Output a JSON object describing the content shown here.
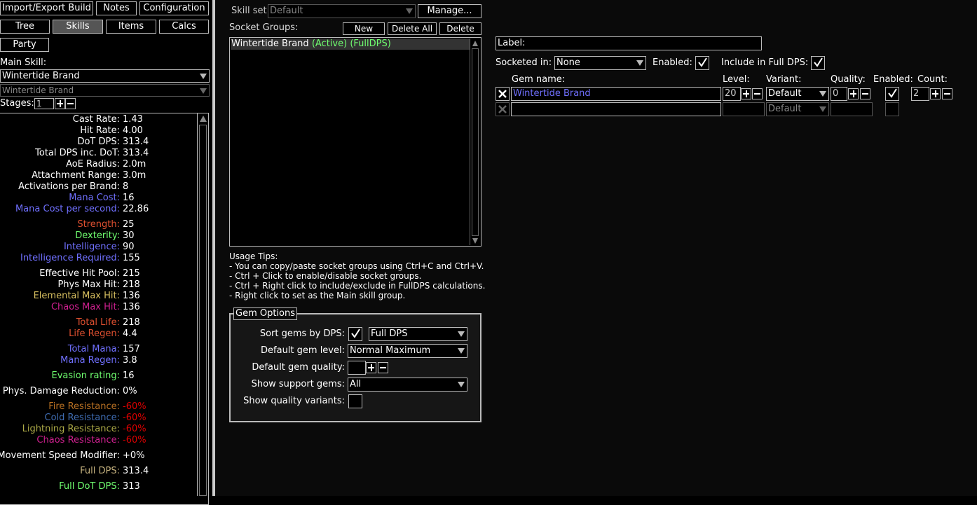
{
  "topbar": {
    "import_export": "Import/Export Build",
    "notes": "Notes",
    "configuration": "Configuration",
    "tabs": [
      "Tree",
      "Skills",
      "Items",
      "Calcs"
    ],
    "party": "Party"
  },
  "sidebar": {
    "main_skill_label": "Main Skill:",
    "main_skill": "Wintertide Brand",
    "sub_skill": "Wintertide Brand",
    "stages_label": "Stages:",
    "stages_value": "1",
    "stats": [
      {
        "label": "Cast Rate:",
        "value": "1.43",
        "cls": ""
      },
      {
        "label": "Hit Rate:",
        "value": "4.00",
        "cls": ""
      },
      {
        "label": "DoT DPS:",
        "value": "313.4",
        "cls": ""
      },
      {
        "label": "Total DPS inc. DoT:",
        "value": "313.4",
        "cls": ""
      },
      {
        "label": "AoE Radius:",
        "value": "2.0m",
        "cls": ""
      },
      {
        "label": "Attachment Range:",
        "value": "3.0m",
        "cls": ""
      },
      {
        "label": "Activations per Brand:",
        "value": "8",
        "cls": ""
      },
      {
        "label": "Mana Cost:",
        "value": "16",
        "cls": "c-mana"
      },
      {
        "label": "Mana Cost per second:",
        "value": "22.86",
        "cls": "c-mana"
      },
      {
        "label": "Strength:",
        "value": "25",
        "cls": "c-str",
        "gap": true
      },
      {
        "label": "Dexterity:",
        "value": "30",
        "cls": "c-dex"
      },
      {
        "label": "Intelligence:",
        "value": "90",
        "cls": "c-int"
      },
      {
        "label": "Intelligence Required:",
        "value": "155",
        "cls": "c-int"
      },
      {
        "label": "Effective Hit Pool:",
        "value": "215",
        "cls": "",
        "gap": true
      },
      {
        "label": "Phys Max Hit:",
        "value": "218",
        "cls": ""
      },
      {
        "label": "Elemental Max Hit:",
        "value": "136",
        "cls": "c-ele"
      },
      {
        "label": "Chaos Max Hit:",
        "value": "136",
        "cls": "c-chaos"
      },
      {
        "label": "Total Life:",
        "value": "218",
        "cls": "c-life",
        "gap": true
      },
      {
        "label": "Life Regen:",
        "value": "4.4",
        "cls": "c-life"
      },
      {
        "label": "Total Mana:",
        "value": "157",
        "cls": "c-mana",
        "gap": true
      },
      {
        "label": "Mana Regen:",
        "value": "3.8",
        "cls": "c-mana"
      },
      {
        "label": "Evasion rating:",
        "value": "16",
        "cls": "c-eva",
        "gap": true
      },
      {
        "label": "Phys. Damage Reduction:",
        "value": "0%",
        "cls": "",
        "gap": true
      },
      {
        "label": "Fire Resistance:",
        "value": "-60%",
        "cls": "c-fire",
        "vcls": "c-neg",
        "gap": true
      },
      {
        "label": "Cold Resistance:",
        "value": "-60%",
        "cls": "c-cold",
        "vcls": "c-neg"
      },
      {
        "label": "Lightning Resistance:",
        "value": "-60%",
        "cls": "c-light",
        "vcls": "c-neg"
      },
      {
        "label": "Chaos Resistance:",
        "value": "-60%",
        "cls": "c-chaos",
        "vcls": "c-neg"
      },
      {
        "label": "Movement Speed Modifier:",
        "value": "+0%",
        "cls": "",
        "gap": true
      },
      {
        "label": "Full DPS:",
        "value": "313.4",
        "cls": "c-fulldps",
        "gap": true
      },
      {
        "label": "Full DoT DPS:",
        "value": "313",
        "cls": "c-dot",
        "gap": true
      }
    ]
  },
  "skills": {
    "skill_set_label": "Skill set:",
    "skill_set_value": "Default",
    "manage": "Manage...",
    "socket_groups_label": "Socket Groups:",
    "new": "New",
    "delete_all": "Delete All",
    "delete": "Delete",
    "group_name": "Wintertide Brand",
    "group_active": "(Active)",
    "group_fulldps": "(FullDPS)",
    "usage_title": "Usage Tips:",
    "tips": [
      "- You can copy/paste socket groups using Ctrl+C and Ctrl+V.",
      "- Ctrl + Click to enable/disable socket groups.",
      "- Ctrl + Right click to include/exclude in FullDPS calculations.",
      "- Right click to set as the Main skill group."
    ]
  },
  "gem_options": {
    "title": "Gem Options",
    "sort_label": "Sort gems by DPS:",
    "sort_value": "Full DPS",
    "level_label": "Default gem level:",
    "level_value": "Normal Maximum",
    "quality_label": "Default gem quality:",
    "support_label": "Show support gems:",
    "support_value": "All",
    "variants_label": "Show quality variants:"
  },
  "group_editor": {
    "label_field": "Label:",
    "socketed_label": "Socketed in:",
    "socketed_value": "None",
    "enabled_label": "Enabled:",
    "fulldps_label": "Include in Full DPS:",
    "headers": {
      "name": "Gem name:",
      "level": "Level:",
      "variant": "Variant:",
      "quality": "Quality:",
      "enabled": "Enabled:",
      "count": "Count:"
    },
    "gem": {
      "name": "Wintertide Brand",
      "level": "20",
      "variant": "Default",
      "quality": "0",
      "count": "2"
    },
    "empty_variant": "Default"
  }
}
